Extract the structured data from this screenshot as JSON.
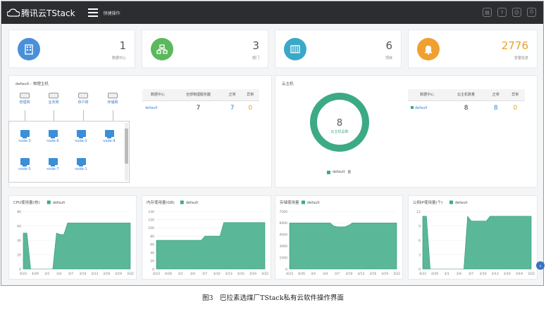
{
  "header": {
    "logo_text": "腾讯云TStack",
    "quick_ops": "快捷操作",
    "icons": [
      "clipboard-icon",
      "help-icon",
      "user-icon",
      "power-icon"
    ]
  },
  "summary": [
    {
      "value": "1",
      "label": "数据中心",
      "color": "#4a90d9",
      "icon": "building-icon"
    },
    {
      "value": "3",
      "label": "部门",
      "color": "#5cb85c",
      "icon": "org-chart-icon"
    },
    {
      "value": "6",
      "label": "项目",
      "color": "#3aa8c8",
      "icon": "project-icon"
    },
    {
      "value": "2776",
      "label": "告警信息",
      "color": "#f0a030",
      "icon": "bell-icon"
    }
  ],
  "physical": {
    "title": "default - 物理主机",
    "networks": [
      "管理网",
      "业务网",
      "存户网",
      "存储网"
    ],
    "nodes": [
      "node-3",
      "node-6",
      "node-2",
      "node-4",
      "node-5",
      "node-7",
      "node-1"
    ]
  },
  "phys_table": {
    "headers": [
      "数据中心",
      "全部物理服务器",
      "正常",
      "异常"
    ],
    "row": {
      "name": "default",
      "total": "7",
      "normal": "7",
      "abnormal": "0"
    }
  },
  "cloud": {
    "title": "云主机",
    "donut_value": "8",
    "donut_label": "云主机总数",
    "legend_name": "default",
    "legend_value": "8",
    "color": "#3daa86"
  },
  "cloud_table": {
    "headers": [
      "数据中心",
      "云主机数量",
      "正常",
      "异常"
    ],
    "row": {
      "name": "default",
      "total": "8",
      "normal": "8",
      "abnormal": "0"
    }
  },
  "x_labels": [
    "4/23",
    "4/26",
    "3/1",
    "3/4",
    "3/7",
    "3/10",
    "3/13",
    "3/16",
    "3/19",
    "3/22"
  ],
  "chart_data": [
    {
      "type": "area",
      "title": "CPU使用量(核)",
      "series_name": "default",
      "y_ticks": [
        "80",
        "60",
        "40",
        "20",
        "0"
      ],
      "ylim": [
        0,
        80
      ],
      "values": [
        50,
        50,
        0,
        0,
        0,
        0,
        0,
        0,
        0,
        50,
        48,
        48,
        64,
        64,
        64,
        64,
        64,
        64,
        64,
        64,
        64,
        64,
        64,
        64,
        64,
        64,
        64,
        64,
        64,
        64
      ]
    },
    {
      "type": "area",
      "title": "内存使用量(GB)",
      "series_name": "default",
      "y_ticks": [
        "140",
        "120",
        "100",
        "80",
        "60",
        "40",
        "20",
        "0"
      ],
      "ylim": [
        0,
        140
      ],
      "values": [
        70,
        70,
        70,
        70,
        70,
        70,
        70,
        70,
        70,
        70,
        70,
        70,
        70,
        80,
        80,
        80,
        80,
        80,
        113,
        113,
        113,
        113,
        113,
        113,
        113,
        113,
        113,
        113,
        113,
        113
      ]
    },
    {
      "type": "area",
      "title": "存储使用量",
      "series_name": "default",
      "y_ticks": [
        "7500",
        "6000",
        "4500",
        "3000",
        "1500",
        "0"
      ],
      "ylim": [
        0,
        7500
      ],
      "values": [
        6000,
        6000,
        6000,
        6000,
        6000,
        6000,
        6000,
        6000,
        6000,
        6000,
        6000,
        6000,
        5600,
        5500,
        5500,
        5500,
        5700,
        6000,
        6000,
        6000,
        6000,
        6000,
        6000,
        6000,
        6000,
        6000,
        6000,
        6000,
        6000,
        6000
      ]
    },
    {
      "type": "area",
      "title": "公网IP使用量(个)",
      "series_name": "default",
      "y_ticks": [
        "12",
        "9",
        "6",
        "3",
        "0"
      ],
      "ylim": [
        0,
        12
      ],
      "values": [
        11,
        11,
        0,
        0,
        0,
        0,
        0,
        0,
        0,
        0,
        0,
        0,
        11,
        10,
        10,
        10,
        10,
        10,
        11,
        11,
        11,
        11,
        11,
        11,
        11,
        11,
        11,
        11,
        11,
        11
      ]
    }
  ],
  "caption": "图3　巴拉素选煤厂TStack私有云软件操作界面"
}
